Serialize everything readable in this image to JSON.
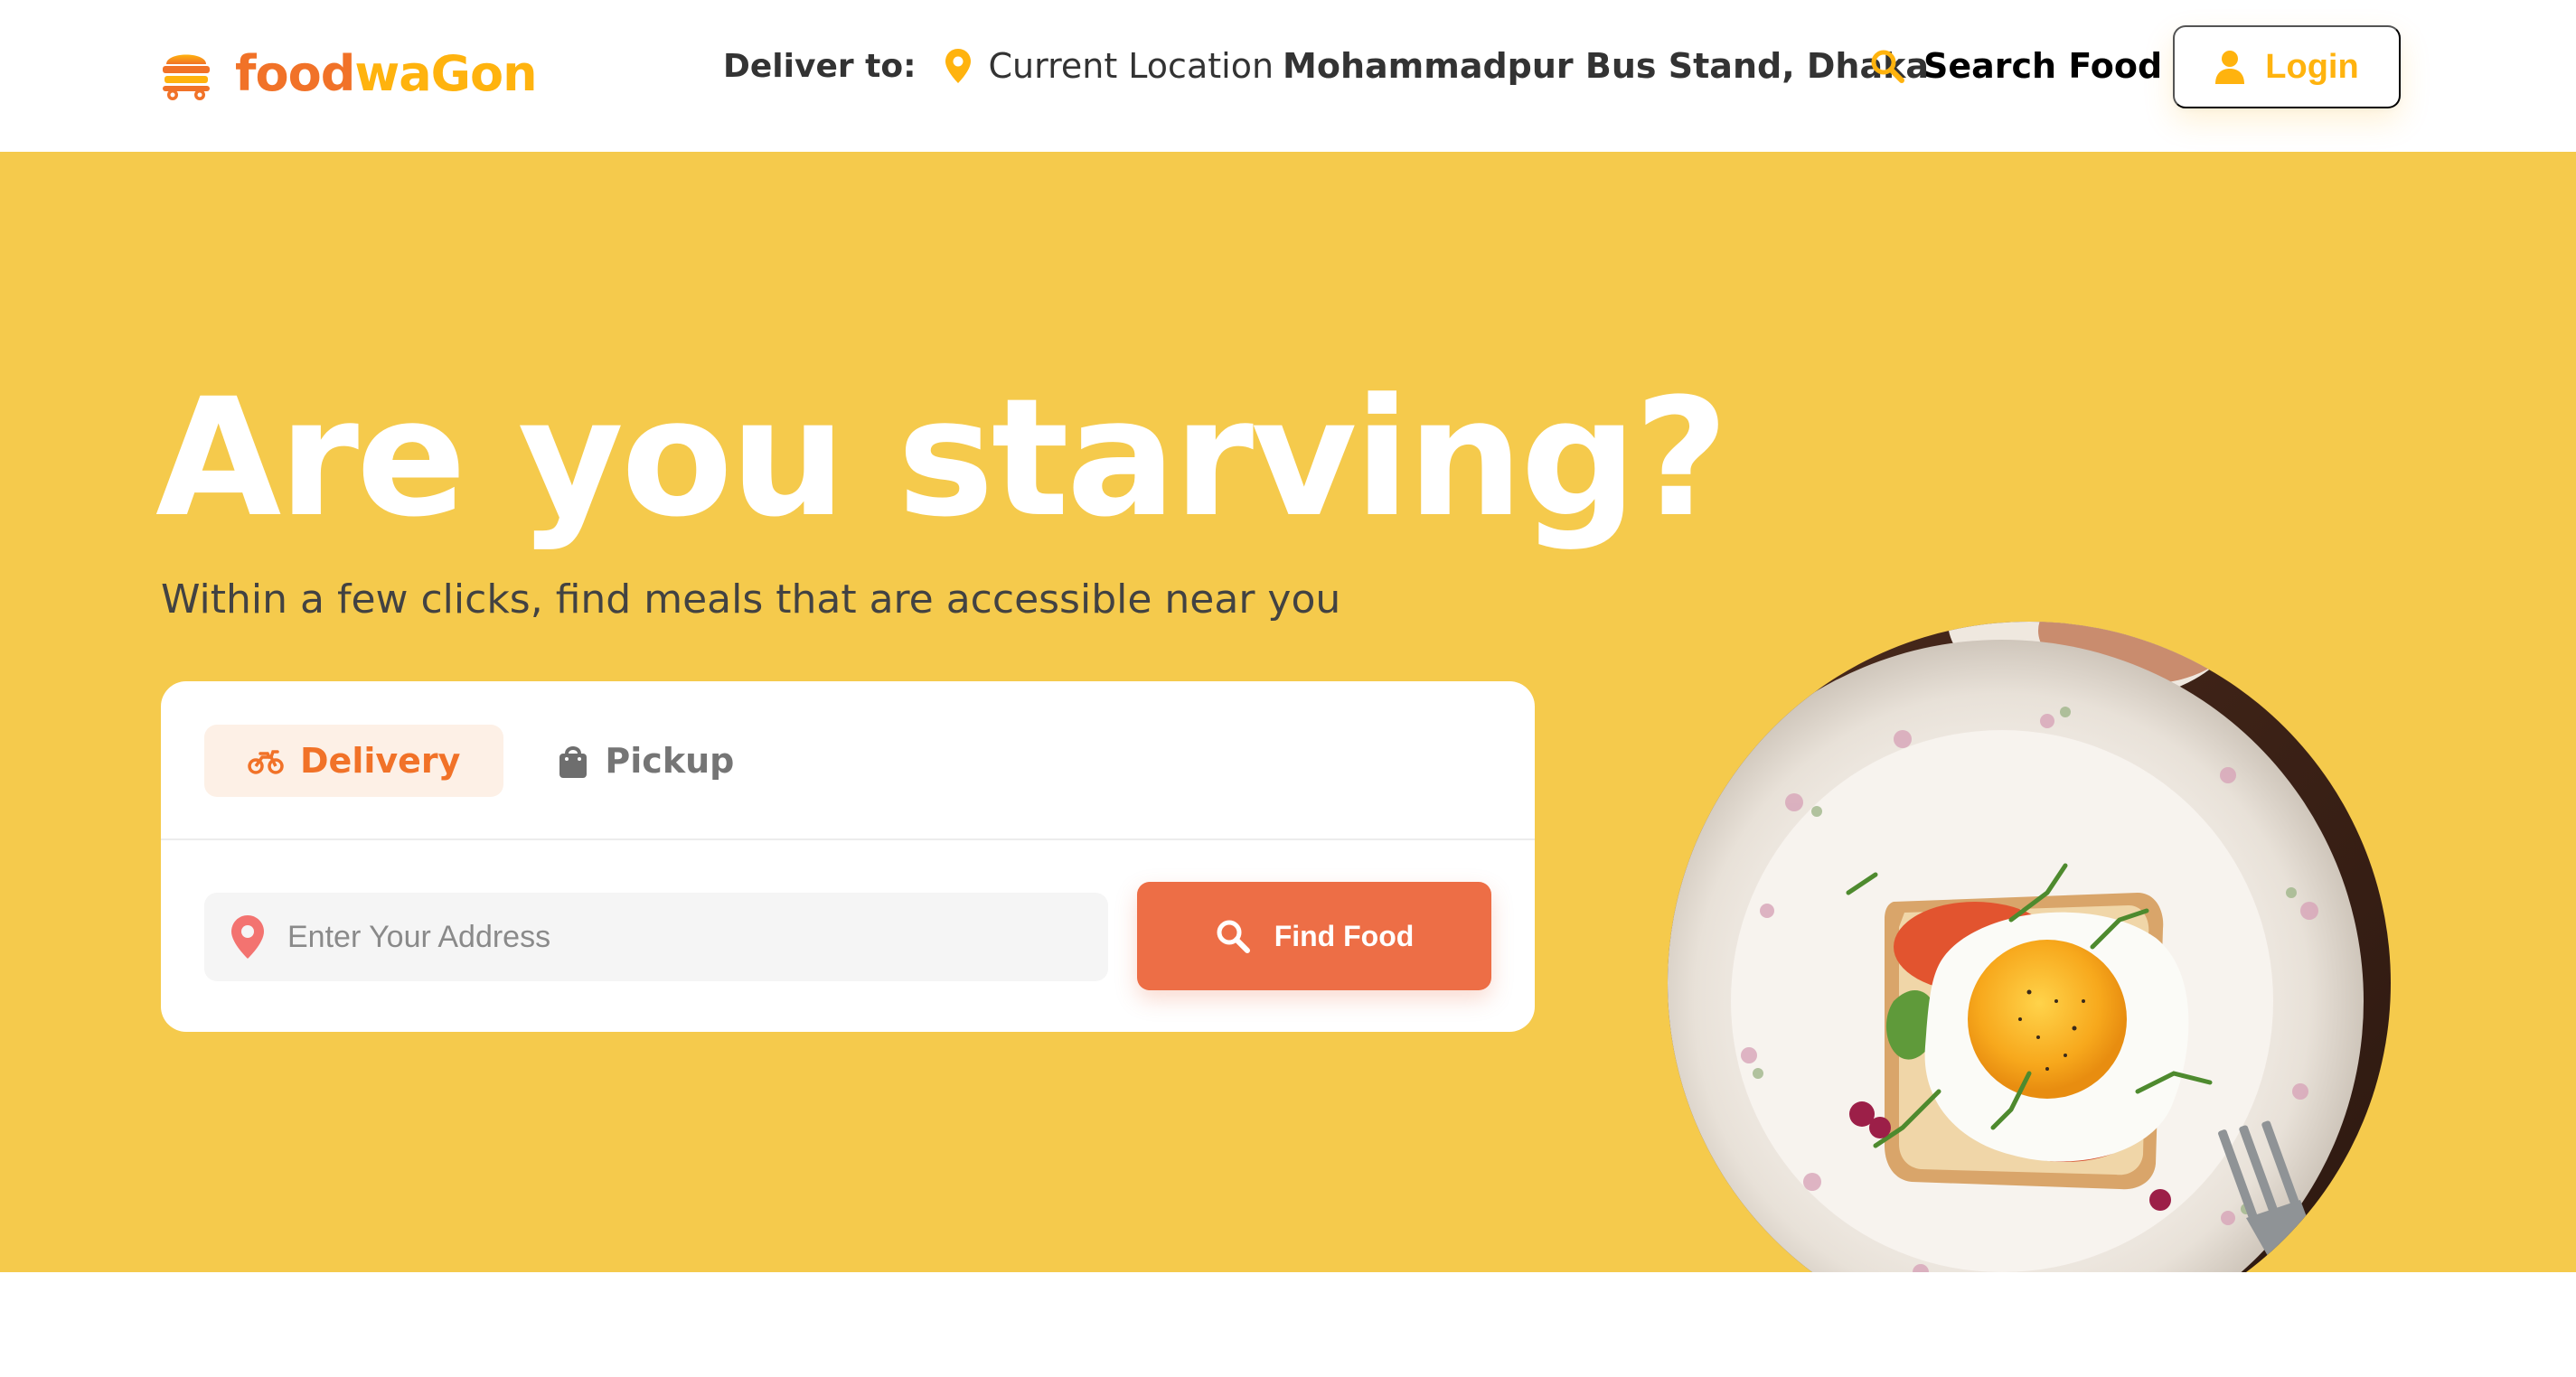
{
  "brand": {
    "name_part1": "food",
    "name_part2": "waGon",
    "primary_color": "#f17228",
    "secondary_color": "#ffb30e"
  },
  "header": {
    "deliver_label": "Deliver to:",
    "current_location_label": "Current Location",
    "location_name": "Mohammadpur Bus Stand, Dhaka",
    "search_food_label": "Search Food",
    "login_label": "Login"
  },
  "hero": {
    "title": "Are you starving?",
    "subtitle": "Within a few clicks, find meals that are accessible near you",
    "background_color": "#f5ca4c"
  },
  "search_card": {
    "tabs": [
      {
        "label": "Delivery",
        "icon": "motorbike-icon",
        "active": true
      },
      {
        "label": "Pickup",
        "icon": "shopping-bag-icon",
        "active": false
      }
    ],
    "address_placeholder": "Enter Your Address",
    "address_value": "",
    "find_button_label": "Find Food",
    "find_button_color": "#ed6e46"
  },
  "icons": {
    "logo": "food-truck-icon",
    "location": "map-pin-icon",
    "search": "search-icon",
    "user": "user-icon",
    "address": "map-pin-icon"
  }
}
